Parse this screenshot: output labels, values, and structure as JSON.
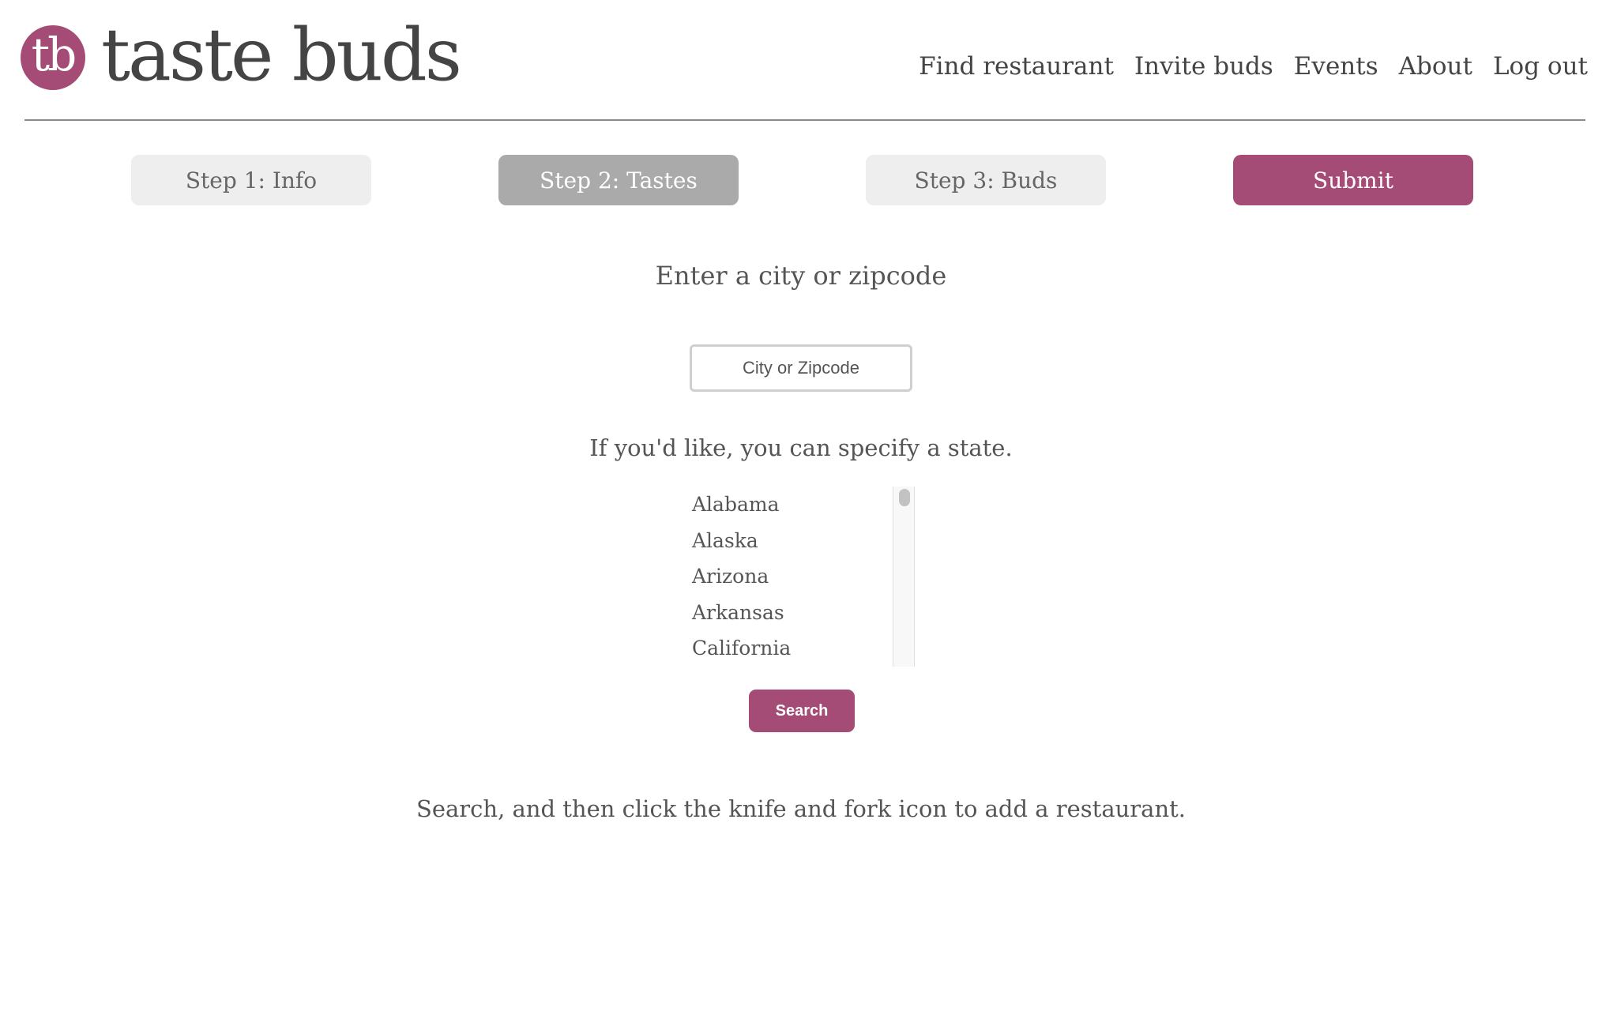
{
  "header": {
    "logo_initials": "tb",
    "brand_name": "taste buds",
    "brand_color": "#a54c76",
    "nav": [
      {
        "label": "Find restaurant"
      },
      {
        "label": "Invite buds"
      },
      {
        "label": "Events"
      },
      {
        "label": "About"
      },
      {
        "label": "Log out"
      }
    ]
  },
  "steps": [
    {
      "label": "Step 1: Info",
      "state": "inactive"
    },
    {
      "label": "Step 2: Tastes",
      "state": "active"
    },
    {
      "label": "Step 3: Buds",
      "state": "inactive"
    },
    {
      "label": "Submit",
      "state": "primary"
    }
  ],
  "form": {
    "city_prompt": "Enter a city or zipcode",
    "city_placeholder": "City or Zipcode",
    "city_value": "",
    "state_prompt": "If you'd like, you can specify a state.",
    "states": [
      "Alabama",
      "Alaska",
      "Arizona",
      "Arkansas",
      "California"
    ],
    "search_label": "Search",
    "hint": "Search, and then click the knife and fork icon to add a restaurant."
  }
}
